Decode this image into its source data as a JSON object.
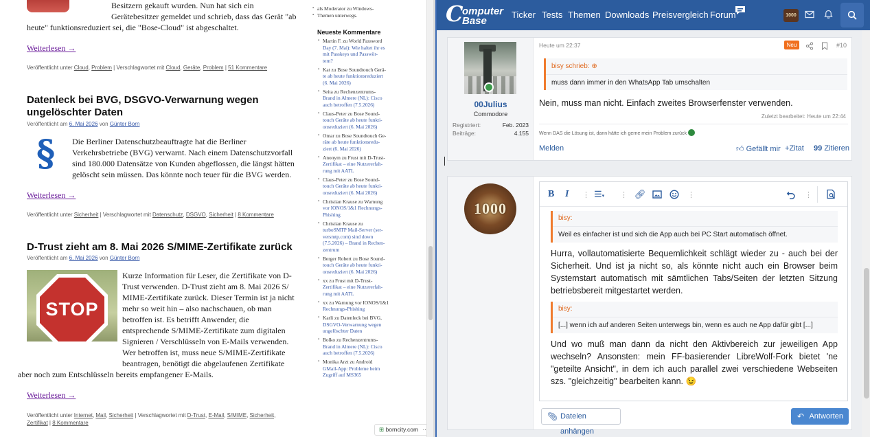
{
  "blog": {
    "article1": {
      "text_lines": [
        "Besitzern gekauft wurden. Nun hat sich ein",
        "Gerätebesitzer gemeldet und schrieb, dass das Gerät \"ab",
        "heute\" funktionsreduziert sei, die \"Bose-Cloud\" ist abgeschaltet."
      ],
      "more": "Weiterlesen →",
      "meta": [
        "Veröffentlicht unter ",
        "Cloud",
        ", ",
        "Problem",
        " | Verschlagwortet mit ",
        "Cloud",
        ", ",
        "Geräte",
        ", ",
        "Problem",
        " | ",
        "51 Kommentare"
      ]
    },
    "article2": {
      "title_line1": "Datenleck bei BVG, DSGVO-Verwarnung wegen",
      "title_line2": "ungelöschter Daten",
      "byline_prefix": "Veröffentlicht am ",
      "date": "6. Mai 2026",
      "byline_mid": " von ",
      "author": "Günter Born",
      "para_symbol": "§",
      "text_lines": [
        "Die Berliner Datenschutzbeauftragte hat die Berliner",
        "Verkehrsbetriebe  (BVG) verwarnt. Nach einem Datenschutzvorfall",
        "sind 180.000 Datensätze von Kunden abgeflossen, die längst hätten",
        "gelöscht sein müssen. Das könnte noch teuer für die BVG werden."
      ],
      "more": "Weiterlesen →",
      "meta": [
        "Veröffentlicht unter ",
        "Sicherheit",
        " | Verschlagwortet mit ",
        "Datenschutz",
        ", ",
        "DSGVO",
        ", ",
        "Sicherheit",
        " | ",
        "8 Kommentare"
      ]
    },
    "article3": {
      "title": "D-Trust zieht am 8. Mai 2026 S/MIME-Zertifikate zurück",
      "byline_prefix": "Veröffentlicht am ",
      "date": "6. Mai 2026",
      "byline_mid": " von ",
      "author": "Günter Born",
      "stop_sign": "STOP",
      "text_lines": [
        "Kurze Information für Leser, die Zertifikate von D-",
        "Trust verwenden. D-Trust zieht am 8. Mai 2026 S/",
        "MIME-Zertifikate zurück. Dieser Termin ist ja nicht",
        "mehr so weit hin – also nachschauen, ob man",
        "betroffen ist. Es betrifft Anwender, die",
        "entsprechende S/MIME-Zertifikate zum digitalen",
        "Signieren / Verschlüsseln von E-Mails verwenden.",
        "Wer betroffen ist, muss neue S/MIME-Zertifikate",
        "beantragen, benötigt die abgelaufenen Zertifikate"
      ],
      "last_line": "aber noch zum Entschlüsseln bereits empfangener E-Mails.",
      "more": "Weiterlesen →",
      "meta_line1": [
        "Veröffentlicht unter ",
        "Internet",
        ", ",
        "Mail",
        ", ",
        "Sicherheit",
        " | Verschlagwortet mit ",
        "D-Trust",
        ", ",
        "E-Mail",
        ", ",
        "S/MIME",
        ", ",
        "Sicherheit",
        ","
      ],
      "meta_line2": [
        "Zertifikat",
        " | ",
        "8 Kommentare"
      ]
    },
    "sidebar": {
      "top_lines": [
        "als Moderator zu Windows-",
        "Themen unterwegs."
      ],
      "title": "Neueste Kommentare",
      "comments": [
        {
          "lines": [
            "Martin F. zu World Password",
            "Day (7. Mai): Wie haltet ihr es",
            "mit Passkeys und Passwör-",
            "tern?"
          ]
        },
        {
          "lines": [
            "Kat zu Bose Soundtouch Gerä-",
            "te ab heute funktionsreduziert",
            "(6. Mai 2026)"
          ]
        },
        {
          "lines": [
            "Seita zu Rechenzentrums-",
            "Brand in Almere (NL): Cisco",
            "auch betroffen (7.5.2026)"
          ]
        },
        {
          "lines": [
            "Claus-Peter zu Bose Sound-",
            "touch Geräte ab heute funkti-",
            "onsreduziert (6. Mai 2026)"
          ]
        },
        {
          "lines": [
            "Omar zu Bose Soundtouch Ge-",
            "räte ab heute funktionsredu-",
            "ziert (6. Mai 2026)"
          ]
        },
        {
          "lines": [
            "Anonym zu Frust mit D-Trust-",
            "Zertifikat – eine Nutzererfah-",
            "rung mit AATL"
          ]
        },
        {
          "lines": [
            "Claus-Peter zu Bose Sound-",
            "touch Geräte ab heute funkti-",
            "onsreduziert (6. Mai 2026)"
          ]
        },
        {
          "lines": [
            "Christian Krause zu Warnung",
            "vor IONOS/1&1 Rechnungs-",
            "Phishing"
          ]
        },
        {
          "lines": [
            "Christian Krause zu",
            "turboSMTP Mail-Server (ser-",
            "versmtp.com) sind down",
            "(7.5.2026) – Brand in Rechen-",
            "zentrum"
          ]
        },
        {
          "lines": [
            "Berger Robert zu Bose Sound-",
            "touch Geräte ab heute funkti-",
            "onsreduziert (6. Mai 2026)"
          ]
        },
        {
          "lines": [
            "xx zu Frust mit D-Trust-",
            "Zertifikat – eine Nutzererfah-",
            "rung mit AATL"
          ]
        },
        {
          "lines": [
            "xx zu Warnung vor IONOS/1&1",
            "Rechnungs-Phishing"
          ]
        },
        {
          "lines": [
            "Karli zu Datenleck bei BVG,",
            "DSGVO-Verwarnung wegen",
            "ungelöschter Daten"
          ]
        },
        {
          "lines": [
            "Bolko zu Rechenzentrums-",
            "Brand in Almere (NL): Cisco",
            "auch betroffen (7.5.2026)"
          ]
        },
        {
          "lines": [
            "Monika Arzt zu Android",
            "GMail-App: Probleme beim",
            "Zugriff auf MS365"
          ]
        }
      ]
    },
    "borncity_label": "borncity.com",
    "borncity_more": "···"
  },
  "forum": {
    "logo": {
      "c": "C",
      "line1": "omputer",
      "line2": "Base"
    },
    "nav": [
      "Ticker",
      "Tests",
      "Themen",
      "Downloads",
      "Preisvergleich",
      "Forum"
    ],
    "avatar_small_text": "1000",
    "post1": {
      "timestamp": "Heute um 22:37",
      "badge": "Neu",
      "post_number": "#10",
      "username": "00Julius",
      "rank": "Commodore",
      "registered_label": "Registriert:",
      "registered_value": "Feb. 2023",
      "posts_label": "Beiträge:",
      "posts_value": "4.155",
      "quote_author": "bisy schrieb:",
      "quote_text": "muss dann immer in den WhatsApp Tab umschalten",
      "body": "Nein, muss man nicht. Einfach zweites Browserfenster verwenden.",
      "edited": "Zuletzt bearbeitet: Heute um 22:44",
      "signature": "Wenn DAS die Lösung ist, dann hätte ich gerne mein Problem zurück",
      "report": "Melden",
      "like": "Gefällt mir",
      "quote_btn": "Zitat",
      "cite_btn": "Zitieren"
    },
    "editor": {
      "avatar_text": "1000",
      "quote1_author": "bisy:",
      "quote1_text": "Weil es einfacher ist und sich die App auch bei PC Start automatisch öffnet.",
      "para1": "Hurra, vollautomatisierte Bequemlichkeit schlägt wieder zu - auch bei der Sicherheit. Und ist ja nicht so, als könnte nicht auch ein Browser beim Systemstart automatisch mit sämtlichen Tabs/Seiten der letzten Sitzung betriebsbereit mitgestartet werden.",
      "quote2_author": "bisy:",
      "quote2_text": "[...] wenn ich auf anderen Seiten unterwegs bin, wenn es auch ne App dafür gibt [...]",
      "para2": "Und wo muß man dann da nicht den Aktivbereich zur jeweiligen App wechseln? Ansonsten: mein FF-basierender LibreWolf-Fork bietet 'ne \"geteilte Ansicht\", in dem ich auch parallel zwei verschiedene Webseiten szs. \"gleichzeitig\" bearbeiten kann. 😉",
      "attach": "Dateien anhängen",
      "reply": "Antworten"
    }
  }
}
